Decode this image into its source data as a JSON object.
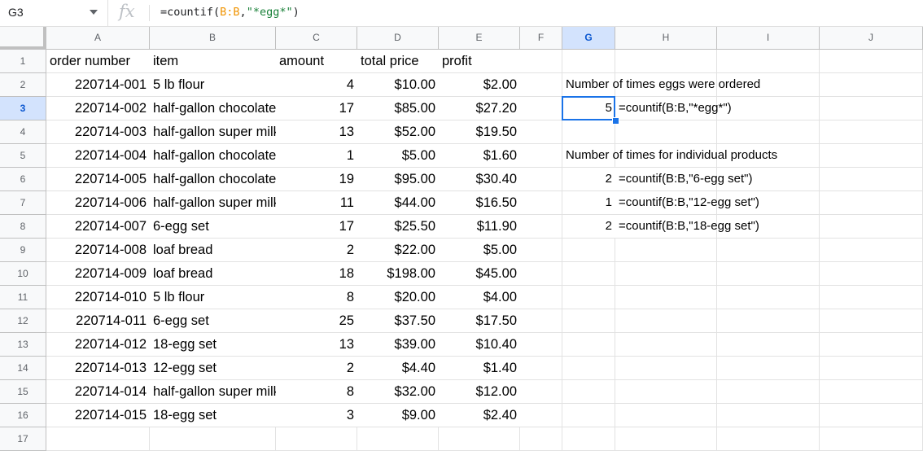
{
  "formula_bar": {
    "name_box": "G3",
    "fx_label": "fx",
    "formula_prefix": "=countif(",
    "formula_ref": "B:B",
    "formula_sep": ",",
    "formula_str": "\"*egg*\"",
    "formula_suffix": ")"
  },
  "columns": [
    "A",
    "B",
    "C",
    "D",
    "E",
    "F",
    "G",
    "H",
    "I",
    "J"
  ],
  "rows": [
    "1",
    "2",
    "3",
    "4",
    "5",
    "6",
    "7",
    "8",
    "9",
    "10",
    "11",
    "12",
    "13",
    "14",
    "15",
    "16",
    "17"
  ],
  "table": {
    "headers": [
      "order number",
      "item",
      "amount",
      "total price",
      "profit"
    ],
    "data": [
      [
        "220714-001",
        "5 lb flour",
        "4",
        "$10.00",
        "$2.00"
      ],
      [
        "220714-002",
        "half-gallon chocolate milk",
        "17",
        "$85.00",
        "$27.20"
      ],
      [
        "220714-003",
        "half-gallon super milk",
        "13",
        "$52.00",
        "$19.50"
      ],
      [
        "220714-004",
        "half-gallon chocolate milk",
        "1",
        "$5.00",
        "$1.60"
      ],
      [
        "220714-005",
        "half-gallon chocolate milk",
        "19",
        "$95.00",
        "$30.40"
      ],
      [
        "220714-006",
        "half-gallon super milk",
        "11",
        "$44.00",
        "$16.50"
      ],
      [
        "220714-007",
        "6-egg set",
        "17",
        "$25.50",
        "$11.90"
      ],
      [
        "220714-008",
        "loaf bread",
        "2",
        "$22.00",
        "$5.00"
      ],
      [
        "220714-009",
        "loaf bread",
        "18",
        "$198.00",
        "$45.00"
      ],
      [
        "220714-010",
        "5 lb flour",
        "8",
        "$20.00",
        "$4.00"
      ],
      [
        "220714-011",
        "6-egg set",
        "25",
        "$37.50",
        "$17.50"
      ],
      [
        "220714-012",
        "18-egg set",
        "13",
        "$39.00",
        "$10.40"
      ],
      [
        "220714-013",
        "12-egg set",
        "2",
        "$4.40",
        "$1.40"
      ],
      [
        "220714-014",
        "half-gallon super milk",
        "8",
        "$32.00",
        "$12.00"
      ],
      [
        "220714-015",
        "18-egg set",
        "3",
        "$9.00",
        "$2.40"
      ]
    ]
  },
  "side": {
    "eggs_title": "Number of times eggs were ordered",
    "eggs_value": "5",
    "eggs_formula": "=countif(B:B,\"*egg*\")",
    "products_title": "Number of times for individual products",
    "products": [
      {
        "value": "2",
        "formula": "=countif(B:B,\"6-egg set\")"
      },
      {
        "value": "1",
        "formula": "=countif(B:B,\"12-egg set\")"
      },
      {
        "value": "2",
        "formula": "=countif(B:B,\"18-egg set\")"
      }
    ]
  }
}
